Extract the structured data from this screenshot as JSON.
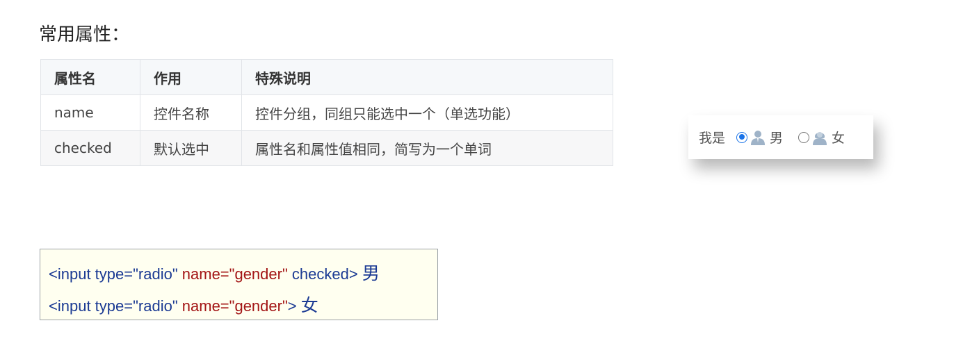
{
  "heading": "常用属性：",
  "table": {
    "headers": [
      "属性名",
      "作用",
      "特殊说明"
    ],
    "rows": [
      [
        "name",
        "控件名称",
        "控件分组，同组只能选中一个（单选功能）"
      ],
      [
        "checked",
        "默认选中",
        "属性名和属性值相同，简写为一个单词"
      ]
    ]
  },
  "demo": {
    "prompt": "我是",
    "options": [
      {
        "label": "男",
        "checked": true,
        "icon": "male-person-icon"
      },
      {
        "label": "女",
        "checked": false,
        "icon": "female-person-icon"
      }
    ],
    "accent_color": "#1a73e8"
  },
  "code": {
    "lines": [
      {
        "tag": "<input type=\"radio\"",
        "attr": "name=\"gender\"",
        "tail": "checked>",
        "label": "男"
      },
      {
        "tag": "<input type=\"radio\"",
        "attr": "name=\"gender\"",
        "tail": ">",
        "label": "女"
      }
    ]
  }
}
